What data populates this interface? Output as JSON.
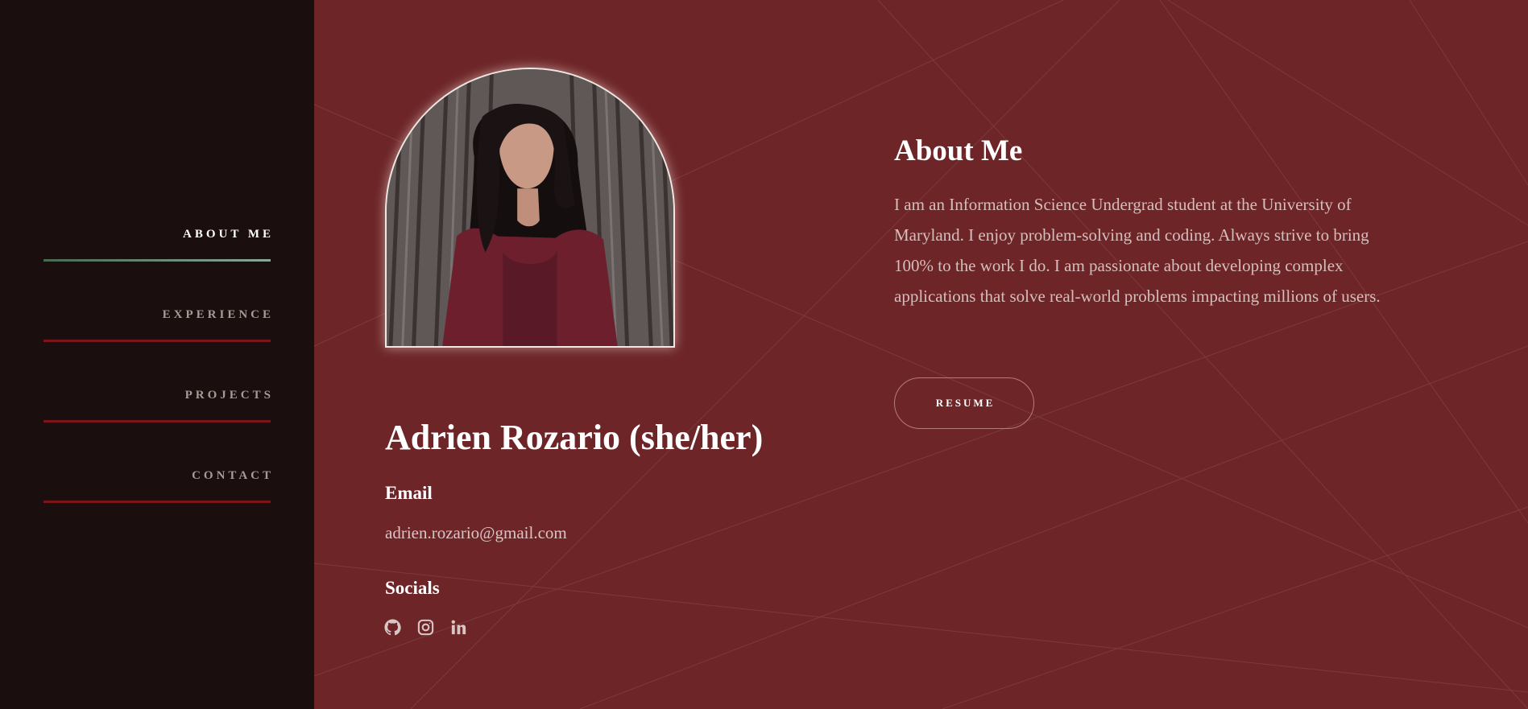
{
  "nav": {
    "items": [
      {
        "label": "ABOUT ME",
        "active": true
      },
      {
        "label": "EXPERIENCE",
        "active": false
      },
      {
        "label": "PROJECTS",
        "active": false
      },
      {
        "label": "CONTACT",
        "active": false
      }
    ]
  },
  "profile": {
    "name": "Adrien Rozario (she/her)",
    "email_heading": "Email",
    "email": "adrien.rozario@gmail.com",
    "socials_heading": "Socials",
    "socials": [
      {
        "icon": "github-icon"
      },
      {
        "icon": "instagram-icon"
      },
      {
        "icon": "linkedin-icon"
      }
    ]
  },
  "about": {
    "title": "About Me",
    "text": "I am an Information Science Undergrad student at the University of Maryland. I enjoy problem-solving and coding. Always strive to bring 100% to the work I do. I am passionate about developing complex applications that solve real-world problems impacting millions of users.",
    "resume_label": "RESUME"
  },
  "colors": {
    "background": "#6d2528",
    "sidebar": "#1a0f0e",
    "nav_underline": "#7a1619",
    "nav_active_underline": "#8aa79a"
  }
}
